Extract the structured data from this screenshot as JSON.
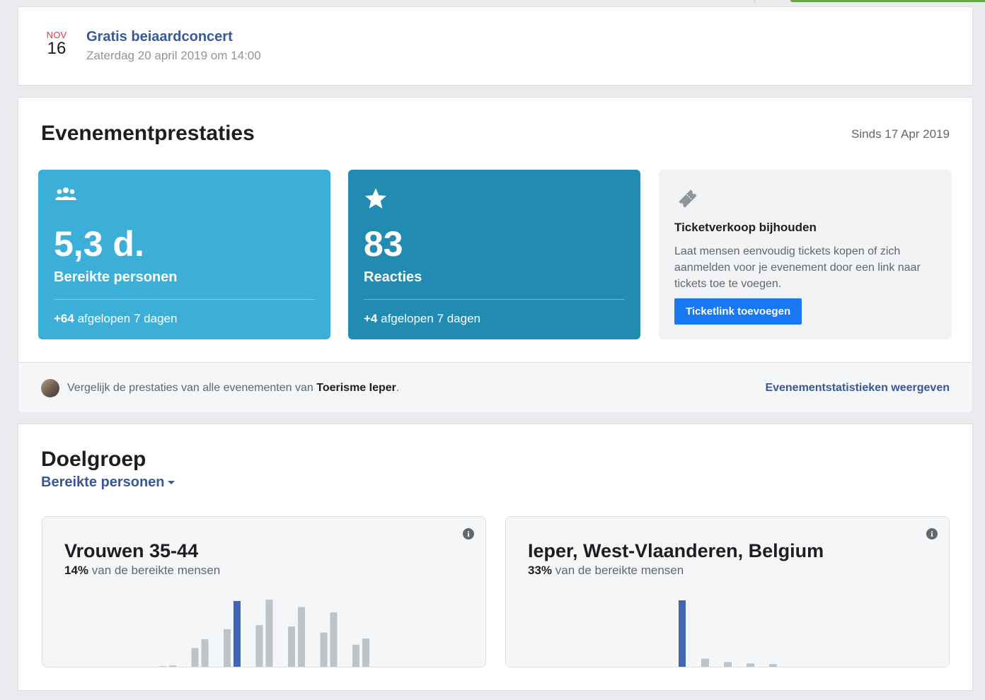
{
  "event": {
    "month": "NOV",
    "day": "16",
    "title": "Gratis beiaardconcert",
    "subtitle": "Zaterdag 20 april 2019 om 14:00"
  },
  "performance": {
    "title": "Evenementprestaties",
    "since": "Sinds 17 Apr 2019",
    "reach": {
      "icon": "people-icon",
      "value": "5,3 d.",
      "label": "Bereikte personen",
      "delta": "+64",
      "delta_suffix": "afgelopen 7 dagen",
      "color": "#3bafd8"
    },
    "reactions": {
      "icon": "star-icon",
      "value": "83",
      "label": "Reacties",
      "delta": "+4",
      "delta_suffix": "afgelopen 7 dagen",
      "color": "#218bb2"
    },
    "tickets": {
      "icon": "ticket-icon",
      "heading": "Ticketverkoop bijhouden",
      "description": "Laat mensen eenvoudig tickets kopen of zich aanmelden voor je evenement door een link naar tickets toe te voegen.",
      "button": "Ticketlink toevoegen"
    },
    "compare": {
      "text_prefix": "Vergelijk de prestaties van alle evenementen van",
      "page_name": "Toerisme Ieper",
      "text_suffix": ".",
      "link": "Evenementstatistieken weergeven"
    }
  },
  "audience": {
    "title": "Doelgroep",
    "dropdown": "Bereikte personen",
    "age_card": {
      "title": "Vrouwen 35-44",
      "percent": "14%",
      "percent_suffix": "van de bereikte mensen",
      "info_icon": "info-icon"
    },
    "location_card": {
      "title": "Ieper, West-Vlaanderen, Belgium",
      "percent": "33%",
      "percent_suffix": "van de bereikte mensen",
      "info_icon": "info-icon"
    }
  },
  "chart_data": [
    {
      "type": "bar",
      "highlight_color": "#4267b2",
      "base_color": "#bec3c9",
      "categories": [
        "a1",
        "b1",
        "a2",
        "b2",
        "a3",
        "b3",
        "a4",
        "b4",
        "a5",
        "b5",
        "a6",
        "b6",
        "a7",
        "b7"
      ],
      "values": [
        0.03,
        0.04,
        0.3,
        0.43,
        0.58,
        1.0,
        0.64,
        1.02,
        0.62,
        0.91,
        0.53,
        0.83,
        0.35,
        0.44
      ],
      "highlight_index": 5
    },
    {
      "type": "bar",
      "highlight_color": "#4267b2",
      "base_color": "#bec3c9",
      "categories": [
        "c1",
        "c2",
        "c3",
        "c4",
        "c5"
      ],
      "values": [
        1.0,
        0.14,
        0.09,
        0.07,
        0.06
      ],
      "highlight_index": 0
    }
  ]
}
